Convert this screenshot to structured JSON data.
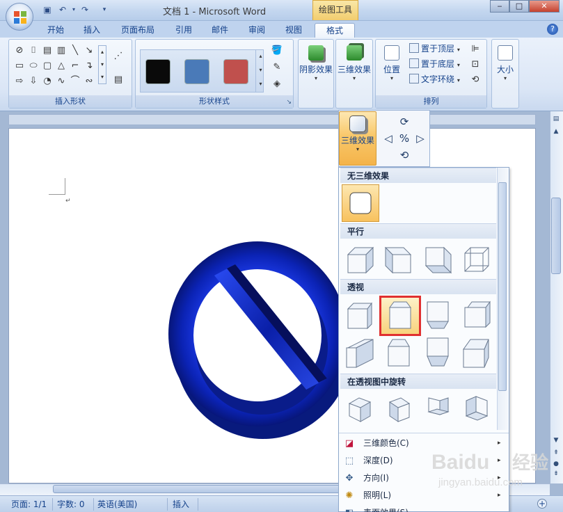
{
  "titlebar": {
    "title": "文档 1 - Microsoft Word",
    "contextual_tab_label": "绘图工具",
    "quick_access": [
      "save-icon",
      "undo-icon",
      "redo-icon",
      "customize-icon"
    ]
  },
  "tabs": [
    {
      "label": "开始"
    },
    {
      "label": "插入"
    },
    {
      "label": "页面布局"
    },
    {
      "label": "引用"
    },
    {
      "label": "邮件"
    },
    {
      "label": "审阅"
    },
    {
      "label": "视图"
    },
    {
      "label": "格式",
      "active": true
    }
  ],
  "ribbon": {
    "insert_shapes": {
      "label": "插入形状"
    },
    "shape_styles": {
      "label": "形状样式",
      "swatches": [
        "#0a0a0a",
        "#4a7ab8",
        "#c0504d"
      ]
    },
    "shadow_effects": {
      "label": "阴影效果"
    },
    "effects_3d": {
      "label": "三维效果"
    },
    "arrange": {
      "label": "排列",
      "position_label": "位置",
      "bring_front_label": "置于顶层",
      "send_back_label": "置于底层",
      "text_wrap_label": "文字环绕"
    },
    "size": {
      "label": "大小"
    }
  },
  "effects_panel": {
    "button_label": "三维效果"
  },
  "gallery": {
    "sections": [
      {
        "title": "无三维效果"
      },
      {
        "title": "平行"
      },
      {
        "title": "透视"
      },
      {
        "title": "在透视图中旋转"
      }
    ]
  },
  "menu": [
    {
      "label": "三维颜色(C)",
      "icon": "paint-bucket-icon"
    },
    {
      "label": "深度(D)",
      "icon": "depth-icon"
    },
    {
      "label": "方向(I)",
      "icon": "direction-icon"
    },
    {
      "label": "照明(L)",
      "icon": "lighting-icon"
    },
    {
      "label": "表面效果(S)",
      "icon": "surface-icon"
    }
  ],
  "statusbar": {
    "page": "页面: 1/1",
    "words": "字数: 0",
    "language": "英语(美国)",
    "mode": "插入"
  },
  "watermark": {
    "brand": "Baidu",
    "cn": "经验",
    "url": "jingyan.baidu.com"
  },
  "colors": {
    "ribbon_bg": "#dbe6f6",
    "highlight_border": "#e03030",
    "shape_blue": "#1434c8",
    "selected_tile": "#f8c25e"
  }
}
